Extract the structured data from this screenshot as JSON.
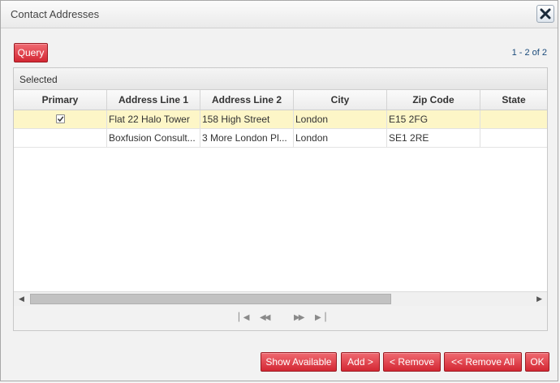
{
  "dialog": {
    "title": "Contact Addresses"
  },
  "toolbar": {
    "query_label": "Query",
    "pager_text": "1 - 2 of 2"
  },
  "panel": {
    "header": "Selected"
  },
  "grid": {
    "columns": [
      "Primary",
      "Address Line 1",
      "Address Line 2",
      "City",
      "Zip Code",
      "State"
    ],
    "rows": [
      {
        "primary": true,
        "address1": "Flat 22 Halo Tower",
        "address2": "158 High Street",
        "city": "London",
        "zip": "E15 2FG",
        "state": ""
      },
      {
        "primary": false,
        "address1": "Boxfusion Consult...",
        "address2": "3 More London Pl...",
        "city": "London",
        "zip": "SE1 2RE",
        "state": ""
      }
    ],
    "selected_row": 0
  },
  "footer": {
    "show_available": "Show Available",
    "add": "Add >",
    "remove": "< Remove",
    "remove_all": "<< Remove All",
    "ok": "OK"
  },
  "colors": {
    "button_red": "#d32733",
    "selected_row": "#fdf6c7",
    "pager_text": "#1a4a7a"
  },
  "icons": [
    "close-icon",
    "checkbox-checked-icon",
    "scroll-left-icon",
    "scroll-right-icon",
    "first-page-icon",
    "previous-page-icon",
    "next-page-icon",
    "last-page-icon"
  ]
}
